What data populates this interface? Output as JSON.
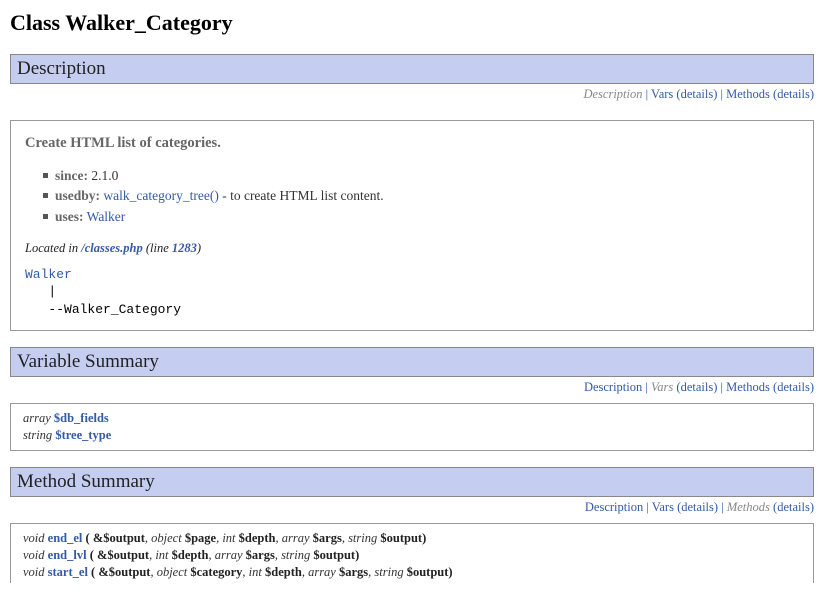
{
  "title": "Class Walker_Category",
  "class_name": "Walker_Category",
  "parent_class": "Walker",
  "nav_labels": {
    "description": "Description",
    "vars": "Vars",
    "details": "details",
    "methods": "Methods"
  },
  "sections": {
    "description": {
      "heading": "Description",
      "disabled": "description"
    },
    "var_summary": {
      "heading": "Variable Summary",
      "disabled": "vars"
    },
    "method_summary": {
      "heading": "Method Summary",
      "disabled": "methods"
    }
  },
  "lead": "Create HTML list of categories.",
  "meta": [
    {
      "label": "since:",
      "text": " 2.1.0"
    },
    {
      "label": "usedby:",
      "link": "walk_category_tree()",
      "text": " - to create HTML list content."
    },
    {
      "label": "uses:",
      "link": "Walker"
    }
  ],
  "located": {
    "prefix": "Located in ",
    "file": "/classes.php",
    "line_label": " (line ",
    "line": "1283",
    "suffix": ")"
  },
  "vars": [
    {
      "type": "array",
      "name": "$db_fields"
    },
    {
      "type": "string",
      "name": "$tree_type"
    }
  ],
  "methods": [
    {
      "ret": "void",
      "name": "end_el",
      "params": [
        {
          "raw": "&$output"
        },
        {
          "type": "object",
          "name": "$page"
        },
        {
          "type": "int",
          "name": "$depth"
        },
        {
          "type": "array",
          "name": "$args"
        },
        {
          "type": "string",
          "name": "$output"
        }
      ]
    },
    {
      "ret": "void",
      "name": "end_lvl",
      "params": [
        {
          "raw": "&$output"
        },
        {
          "type": "int",
          "name": "$depth"
        },
        {
          "type": "array",
          "name": "$args"
        },
        {
          "type": "string",
          "name": "$output"
        }
      ]
    },
    {
      "ret": "void",
      "name": "start_el",
      "params": [
        {
          "raw": "&$output"
        },
        {
          "type": "object",
          "name": "$category"
        },
        {
          "type": "int",
          "name": "$depth"
        },
        {
          "type": "array",
          "name": "$args"
        },
        {
          "type": "string",
          "name": "$output"
        }
      ]
    }
  ]
}
